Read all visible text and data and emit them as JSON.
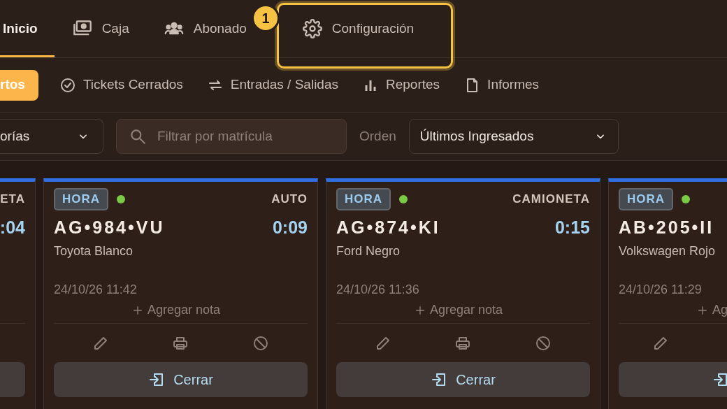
{
  "nav_tabs": [
    {
      "label": "Inicio",
      "selected": true
    },
    {
      "label": "Caja",
      "selected": false
    },
    {
      "label": "Abonado",
      "selected": false
    },
    {
      "label": "Configuración",
      "selected": false
    }
  ],
  "callout": {
    "number": "1"
  },
  "sub_tabs": [
    {
      "label": "rtos",
      "selected": true
    },
    {
      "label": "Tickets Cerrados",
      "selected": false
    },
    {
      "label": "Entradas / Salidas",
      "selected": false
    },
    {
      "label": "Reportes",
      "selected": false
    },
    {
      "label": "Informes",
      "selected": false
    }
  ],
  "filters": {
    "category": {
      "value": "orías"
    },
    "search": {
      "placeholder": "Filtrar por matrícula"
    },
    "order_label": "Orden",
    "order": {
      "value": "Últimos Ingresados"
    }
  },
  "tickets": [
    {
      "vehicle_type": "ETA",
      "elapsed": ":04"
    },
    {
      "rate": "HORA",
      "active": true,
      "vehicle_type": "AUTO",
      "plate": "AG•984•VU",
      "elapsed": "0:09",
      "car": "Toyota Blanco",
      "entry": "24/10/26 11:42",
      "note": "Agregar nota",
      "action": "Cerrar"
    },
    {
      "rate": "HORA",
      "active": true,
      "vehicle_type": "CAMIONETA",
      "plate": "AG•874•KI",
      "elapsed": "0:15",
      "car": "Ford Negro",
      "entry": "24/10/26 11:36",
      "note": "Agregar nota",
      "action": "Cerrar"
    },
    {
      "rate": "HORA",
      "active": true,
      "plate": "AB•205•II",
      "car": "Volkswagen Rojo",
      "entry": "24/10/26 11:29",
      "note": "Ag"
    }
  ]
}
